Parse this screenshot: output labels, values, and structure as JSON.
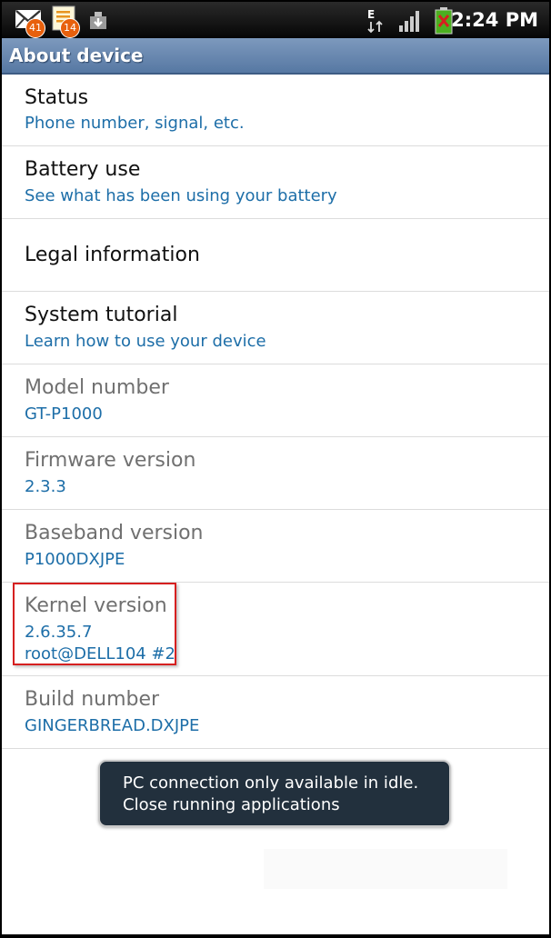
{
  "status_bar": {
    "time": "2:24 PM",
    "notifications": [
      {
        "icon": "mail-icon",
        "count": "41"
      },
      {
        "icon": "message-icon",
        "count": "14"
      },
      {
        "icon": "download-icon"
      }
    ],
    "indicators": [
      "edge-data-icon",
      "signal-icon",
      "battery-icon"
    ]
  },
  "header": {
    "title": "About device"
  },
  "items": [
    {
      "title": "Status",
      "subtitle": "Phone number, signal, etc."
    },
    {
      "title": "Battery use",
      "subtitle": "See what has been using your battery"
    },
    {
      "title": "Legal information"
    },
    {
      "title": "System tutorial",
      "subtitle": "Learn how to use your device"
    },
    {
      "title": "Model number",
      "subtitle": "GT-P1000"
    },
    {
      "title": "Firmware version",
      "subtitle": "2.3.3"
    },
    {
      "title": "Baseband version",
      "subtitle": "P1000DXJPE"
    },
    {
      "title": "Kernel version",
      "subtitle": "2.6.35.7",
      "subtitle2": "root@DELL104 #2"
    },
    {
      "title": "Build number",
      "subtitle": "GINGERBREAD.DXJPE"
    }
  ],
  "toast": {
    "line1": "PC connection only available in idle.",
    "line2": "Close running applications"
  },
  "colors": {
    "title_bar": "#6a88b0",
    "subtitle_text": "#1d6ea8",
    "highlight": "#d62020",
    "toast_bg": "#22303d",
    "battery": "#4caf20"
  }
}
